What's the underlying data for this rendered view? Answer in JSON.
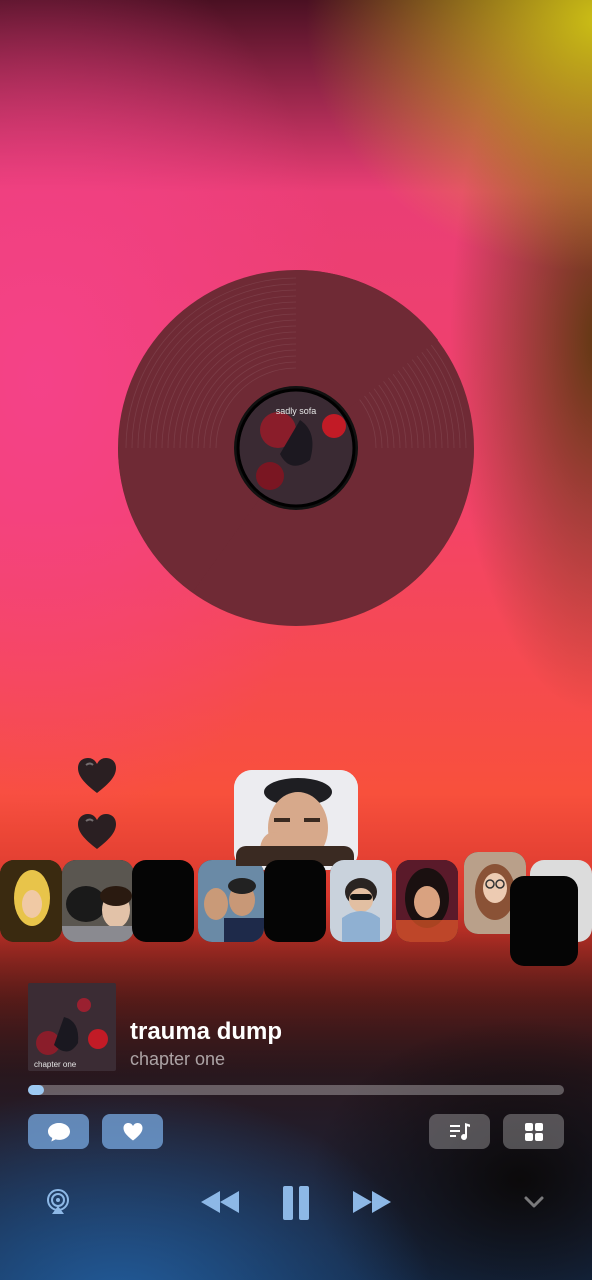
{
  "now_playing": {
    "title": "trauma dump",
    "subtitle": "chapter one",
    "artwork_text": "chapter one",
    "label_text": "sadly sofa",
    "progress": 0.03
  },
  "reactions": [
    "heart-icon",
    "heart-icon"
  ],
  "participants_count": 11,
  "actions": {
    "chat": "chat-bubble-icon",
    "like": "heart-icon",
    "queue": "queue-icon",
    "grid": "grid-icon"
  },
  "controls": {
    "airplay": "airplay-icon",
    "rewind": "rewind-icon",
    "pause": "pause-icon",
    "forward": "fast-forward-icon",
    "collapse": "chevron-down-icon"
  },
  "colors": {
    "accent_blue": "#78aae1",
    "vinyl": "#6f2a35",
    "progress_fill": "#9cc9f2"
  }
}
